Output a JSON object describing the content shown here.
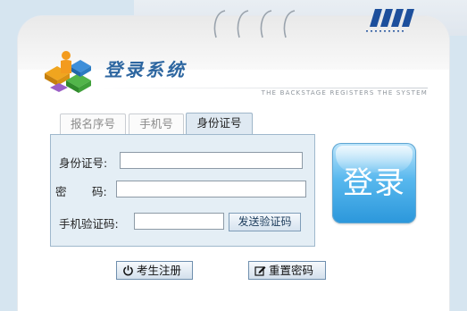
{
  "header": {
    "title": "登录系统",
    "subtitle": "THE BACKSTAGE REGISTERS THE SYSTEM"
  },
  "tabs": [
    {
      "label": "报名序号",
      "active": false
    },
    {
      "label": "手机号",
      "active": false
    },
    {
      "label": "身份证号",
      "active": true
    }
  ],
  "form": {
    "id_label": "身份证号:",
    "id_value": "",
    "password_label_1": "密",
    "password_label_2": "码:",
    "password_value": "",
    "sms_label": "手机验证码:",
    "sms_value": "",
    "send_code_label": "发送验证码"
  },
  "login_button": "登录",
  "bottom": {
    "register_label": "考生注册",
    "reset_label": "重置密码"
  },
  "colors": {
    "background": "#d6e5f0",
    "accent": "#2b97db",
    "panel": "#e4eef5"
  }
}
